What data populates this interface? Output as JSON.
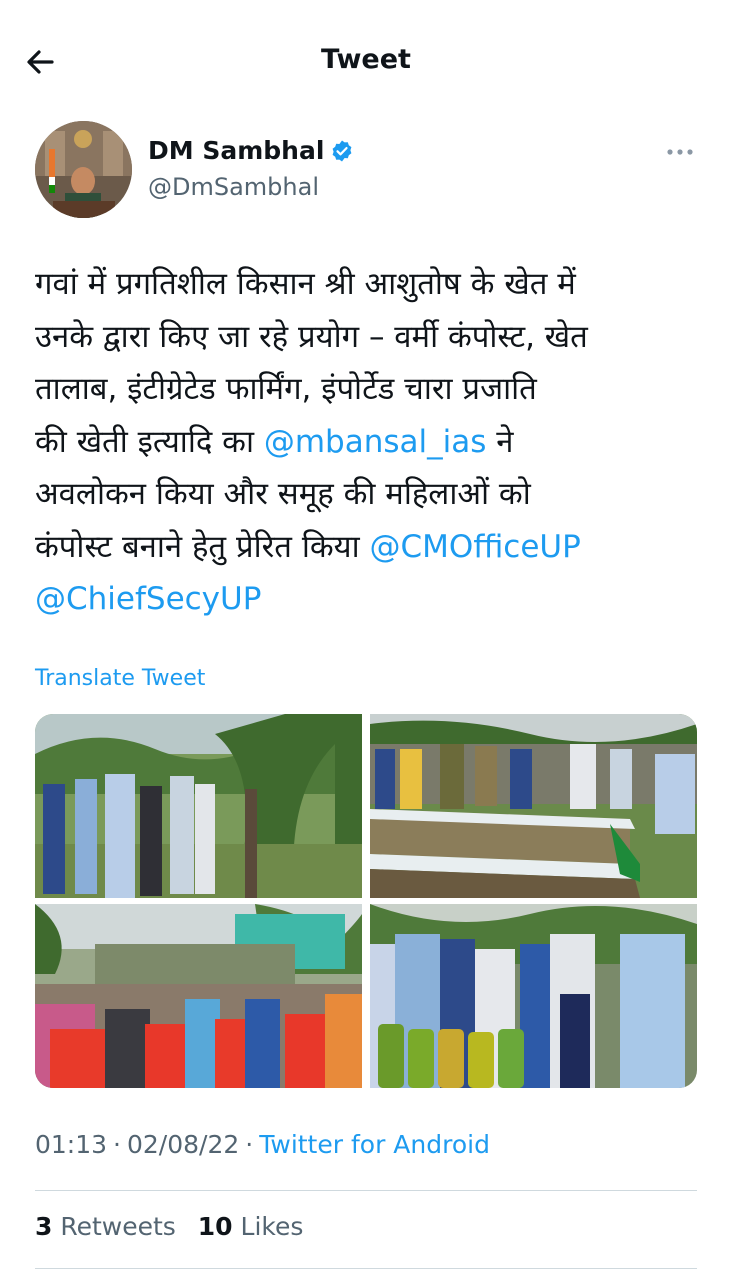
{
  "header": {
    "title": "Tweet",
    "back_icon": "arrow-left-icon"
  },
  "author": {
    "name": "DM Sambhal",
    "handle": "@DmSambhal",
    "verified_icon": "verified-badge-icon",
    "verified_color": "#1d9bf0",
    "more_icon": "more-horizontal-icon"
  },
  "tweet": {
    "line1": "गवां में प्रगतिशील किसान श्री आशुतोष के खेत में",
    "line2": "उनके द्वारा किए जा रहे प्रयोग – वर्मी कंपोस्ट, खेत",
    "line3": "तालाब, इंटीग्रेटेड फार्मिंग, इंपोर्टेड चारा प्रजाति",
    "line4_text": "की खेती इत्यादि का ",
    "mention1": "@mbansal_ias",
    "line4_tail": " ने",
    "line5": "अवलोकन किया और समूह की महिलाओं को",
    "line6_text": "कंपोस्ट बनाने हेतु प्रेरित किया ",
    "mention2": "@CMOfficeUP",
    "mention3": "@ChiefSecyUP",
    "translate_label": "Translate Tweet"
  },
  "meta": {
    "time": "01:13",
    "date": "02/08/22",
    "separator": "·",
    "source": "Twitter for Android"
  },
  "stats": {
    "retweets_count": "3",
    "retweets_label": "Retweets",
    "likes_count": "10",
    "likes_label": "Likes"
  },
  "colors": {
    "link": "#1d9bf0",
    "secondary_text": "#536471",
    "divider": "#cfd9de"
  }
}
